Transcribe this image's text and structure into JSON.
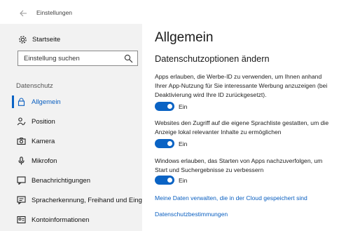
{
  "window": {
    "title": "Einstellungen"
  },
  "sidebar": {
    "home_label": "Startseite",
    "search_placeholder": "Einstellung suchen",
    "section_label": "Datenschutz",
    "items": [
      {
        "label": "Allgemein",
        "icon": "lock-icon",
        "active": true
      },
      {
        "label": "Position",
        "icon": "location-person-icon",
        "active": false
      },
      {
        "label": "Kamera",
        "icon": "camera-icon",
        "active": false
      },
      {
        "label": "Mikrofon",
        "icon": "microphone-icon",
        "active": false
      },
      {
        "label": "Benachrichtigungen",
        "icon": "notification-icon",
        "active": false
      },
      {
        "label": "Spracherkennung, Freihand und Eingabe",
        "icon": "speech-input-icon",
        "active": false
      },
      {
        "label": "Kontoinformationen",
        "icon": "account-info-icon",
        "active": false
      }
    ]
  },
  "main": {
    "title": "Allgemein",
    "subtitle": "Datenschutzoptionen ändern",
    "options": [
      {
        "lines": [
          "Apps erlauben, die Werbe-ID zu verwenden, um Ihnen anhand",
          "Ihrer App-Nutzung für Sie interessante Werbung anzuzeigen (bei",
          "Deaktivierung wird Ihre ID zurückgesetzt)."
        ],
        "state": "Ein",
        "on": true
      },
      {
        "lines": [
          "Websites den Zugriff auf die eigene Sprachliste gestatten, um die",
          "Anzeige lokal relevanter Inhalte zu ermöglichen"
        ],
        "state": "Ein",
        "on": true
      },
      {
        "lines": [
          "Windows erlauben, das Starten von Apps nachzuverfolgen, um",
          "Start und Suchergebnisse zu verbessern"
        ],
        "state": "Ein",
        "on": true
      }
    ],
    "links": [
      "Meine Daten verwalten, die in der Cloud gespeichert sind",
      "Datenschutzbestimmungen"
    ]
  },
  "colors": {
    "accent": "#0a63c4",
    "sidebar_bg": "#f2f2f2",
    "link": "#0a5fc0"
  }
}
